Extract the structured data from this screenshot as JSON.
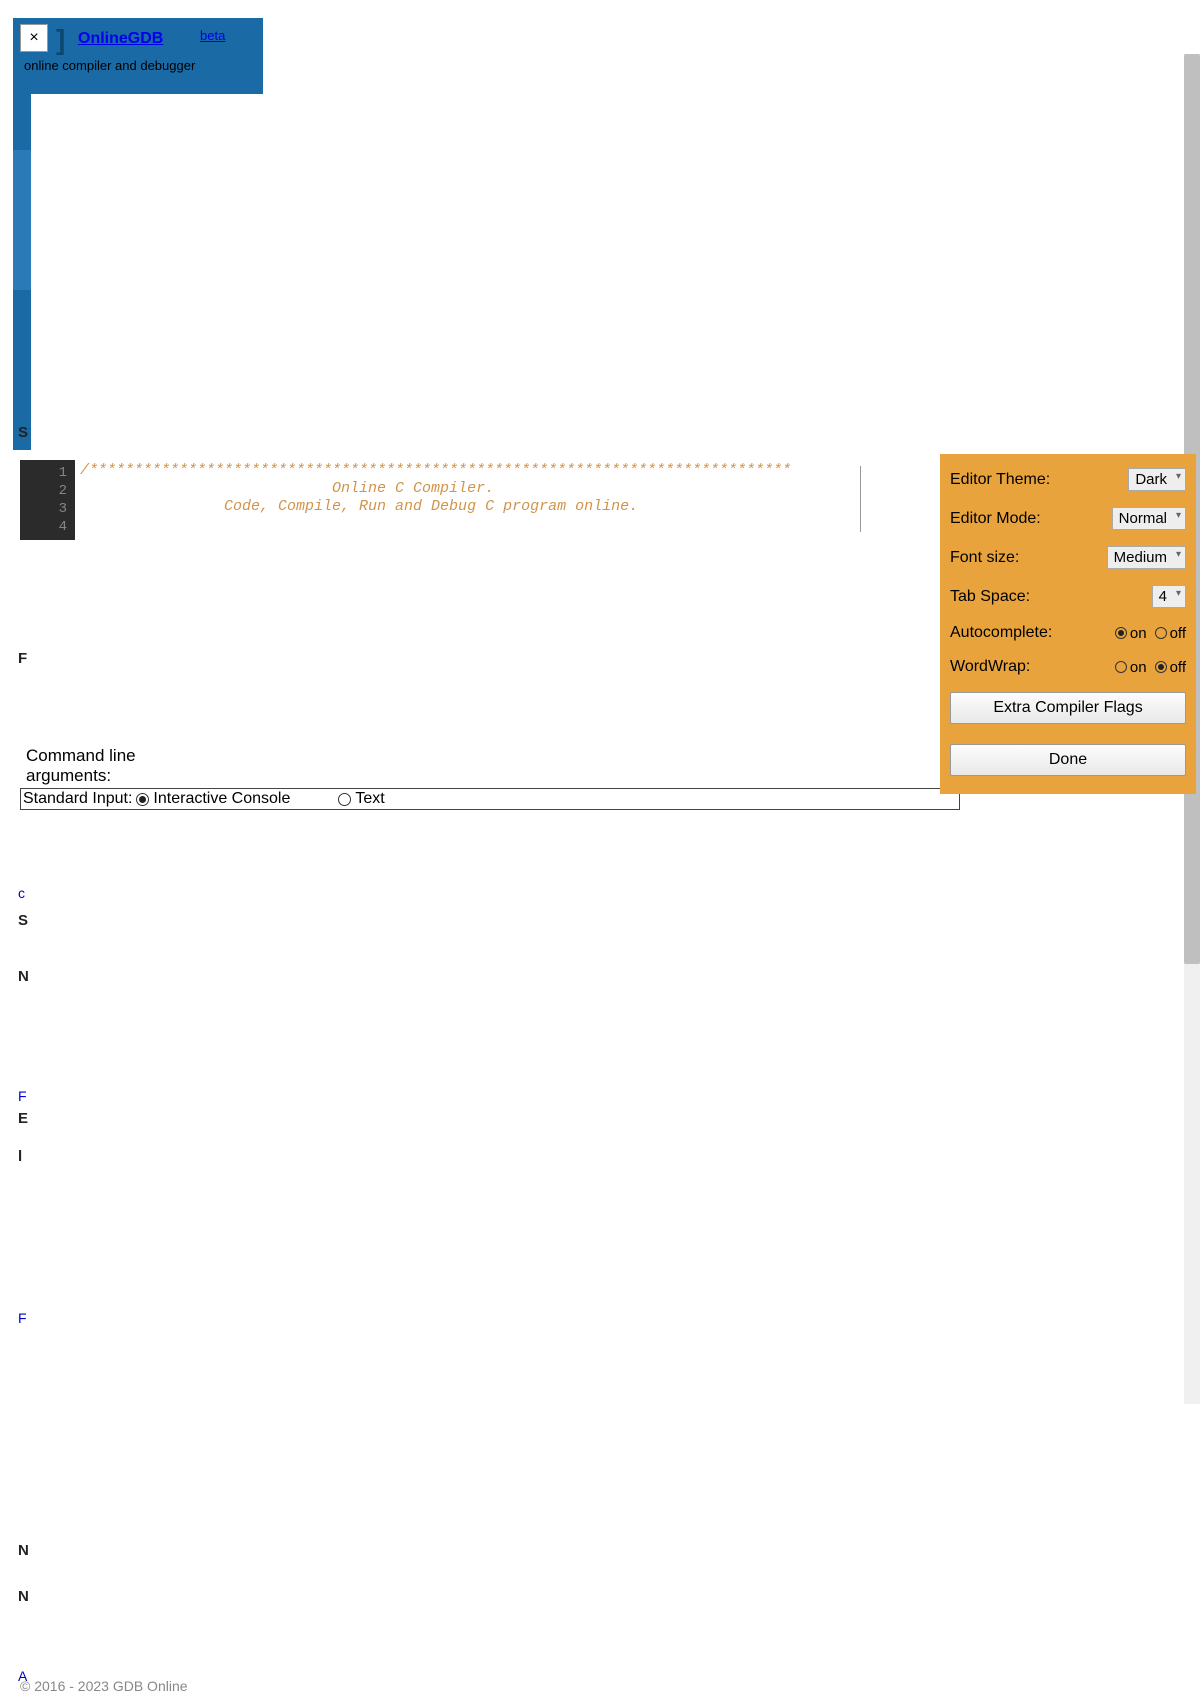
{
  "header": {
    "close": "×",
    "brand": "OnlineGDB",
    "beta": "beta",
    "tagline": "online compiler and debugger"
  },
  "editor": {
    "lines": [
      "1",
      "2",
      "3",
      "4"
    ],
    "comment_stars": "/******************************************************************************",
    "comment_l2": "                            Online C Compiler.",
    "comment_l3": "                Code, Compile, Run and Debug C program online."
  },
  "cmdline": {
    "label1": "Command line",
    "label2": "arguments:",
    "stdin_label": "Standard Input:",
    "opt_interactive": "Interactive Console",
    "opt_text": "Text"
  },
  "settings": {
    "theme_label": "Editor Theme:",
    "theme_value": "Dark",
    "mode_label": "Editor Mode:",
    "mode_value": "Normal",
    "font_label": "Font size:",
    "font_value": "Medium",
    "tab_label": "Tab Space:",
    "tab_value": "4",
    "auto_label": "Autocomplete:",
    "wrap_label": "WordWrap:",
    "on": "on",
    "off": "off",
    "flags_btn": "Extra Compiler Flags",
    "done_btn": "Done"
  },
  "faint": {
    "c": "c",
    "s": "S",
    "n": "N",
    "f": "F",
    "e": "E",
    "l": "l",
    "f2": "F",
    "n2": "N",
    "n3": "N",
    "a": "A"
  },
  "footer": "© 2016 - 2023 GDB Online"
}
